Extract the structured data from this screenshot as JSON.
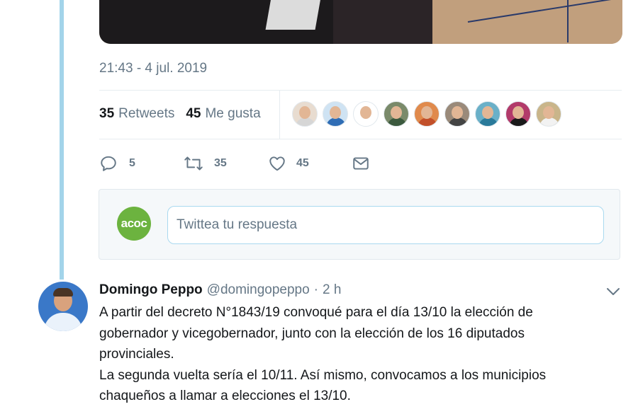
{
  "tweet_detail": {
    "timestamp": "21:43 - 4 jul. 2019",
    "stats": {
      "retweets_count": "35",
      "retweets_label": "Retweets",
      "likes_count": "45",
      "likes_label": "Me gusta"
    },
    "liker_avatars": [
      {
        "name": "liker-avatar-1",
        "shirt": "#d6d6d6",
        "bg": "#e8dcd0"
      },
      {
        "name": "liker-avatar-2",
        "shirt": "#2f6db5",
        "bg": "#cfe3f3"
      },
      {
        "name": "liker-avatar-3",
        "shirt": "#ffffff",
        "bg": "#ffffff"
      },
      {
        "name": "liker-avatar-4",
        "shirt": "#3c5a3e",
        "bg": "#7a8a6a"
      },
      {
        "name": "liker-avatar-5",
        "shirt": "#c2502a",
        "bg": "#e08a4c"
      },
      {
        "name": "liker-avatar-6",
        "shirt": "#444444",
        "bg": "#9a8a7a"
      },
      {
        "name": "liker-avatar-7",
        "shirt": "#2a7a9a",
        "bg": "#6ab0c8"
      },
      {
        "name": "liker-avatar-8",
        "shirt": "#1a1a1a",
        "bg": "#b23a6a"
      },
      {
        "name": "liker-avatar-9",
        "shirt": "#f2f2f2",
        "bg": "#c9b58a"
      }
    ],
    "actions": {
      "reply_count": "5",
      "retweet_count": "35",
      "like_count": "45"
    },
    "reply_placeholder": "Twittea tu respuesta",
    "reply_avatar_text": "acoc"
  },
  "tweet": {
    "name": "Domingo Peppo",
    "handle": "@domingopeppo",
    "dot": "·",
    "time": "2 h",
    "text_line1": "A partir del decreto N°1843/19 convoqué para el día 13/10 la elección de gobernador y vicegobernador, junto con la elección de los 16 diputados provinciales.",
    "text_line2": "La segunda vuelta sería el 10/11. Así mismo, convocamos a los municipios chaqueños a llamar a elecciones el 13/10."
  },
  "colors": {
    "thread_line": "#a3d4ea",
    "secondary_text": "#657786",
    "primary_text": "#14171a",
    "reply_box_bg": "#f5f8fa"
  }
}
